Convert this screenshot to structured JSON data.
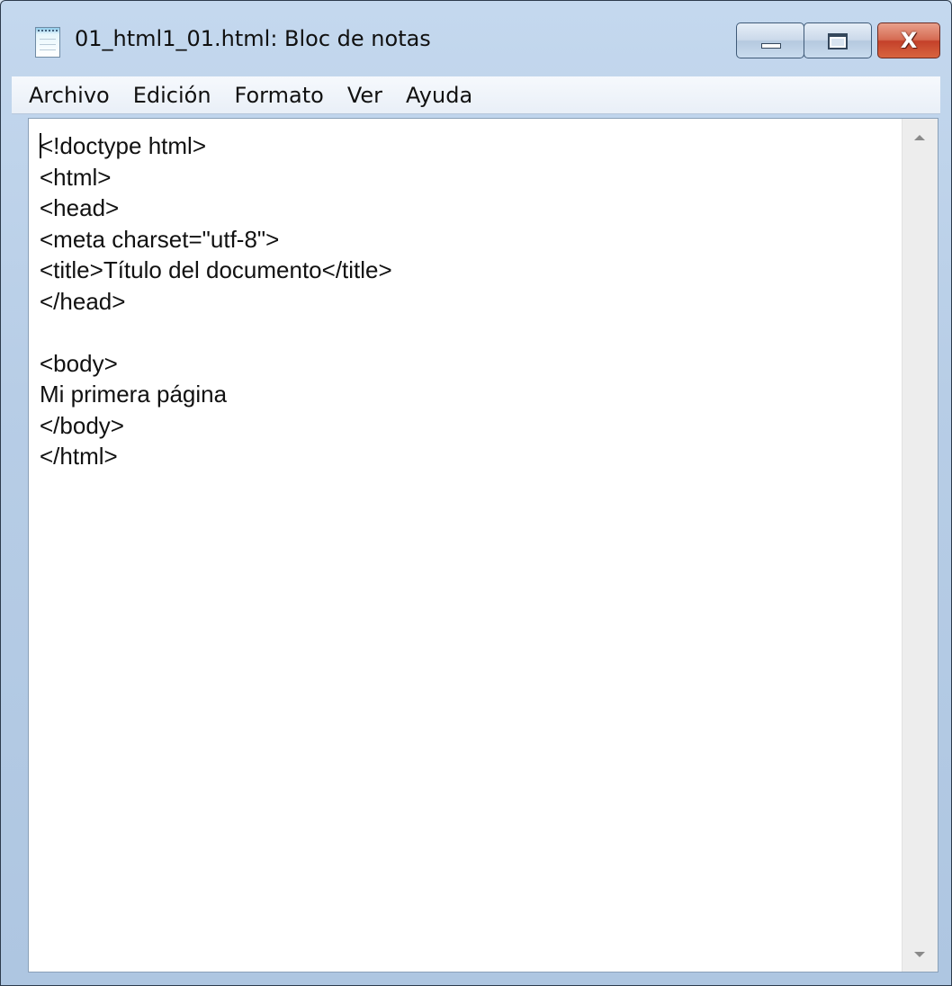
{
  "window": {
    "title": "01_html1_01.html: Bloc de notas",
    "app_icon": "notepad-icon"
  },
  "caption_buttons": {
    "minimize_icon": "minimize-icon",
    "maximize_icon": "maximize-icon",
    "close_glyph": "X"
  },
  "menu": {
    "items": [
      "Archivo",
      "Edición",
      "Formato",
      "Ver",
      "Ayuda"
    ]
  },
  "editor": {
    "lines": [
      "<!doctype html>",
      "<html>",
      "<head>",
      "<meta charset=\"utf-8\">",
      "<title>Título del documento</title>",
      "</head>",
      "",
      "<body>",
      "Mi primera página",
      "</body>",
      "</html>"
    ]
  },
  "colors": {
    "frame": "#aec6e1",
    "close_button": "#c4412a",
    "editor_background": "#ffffff"
  }
}
